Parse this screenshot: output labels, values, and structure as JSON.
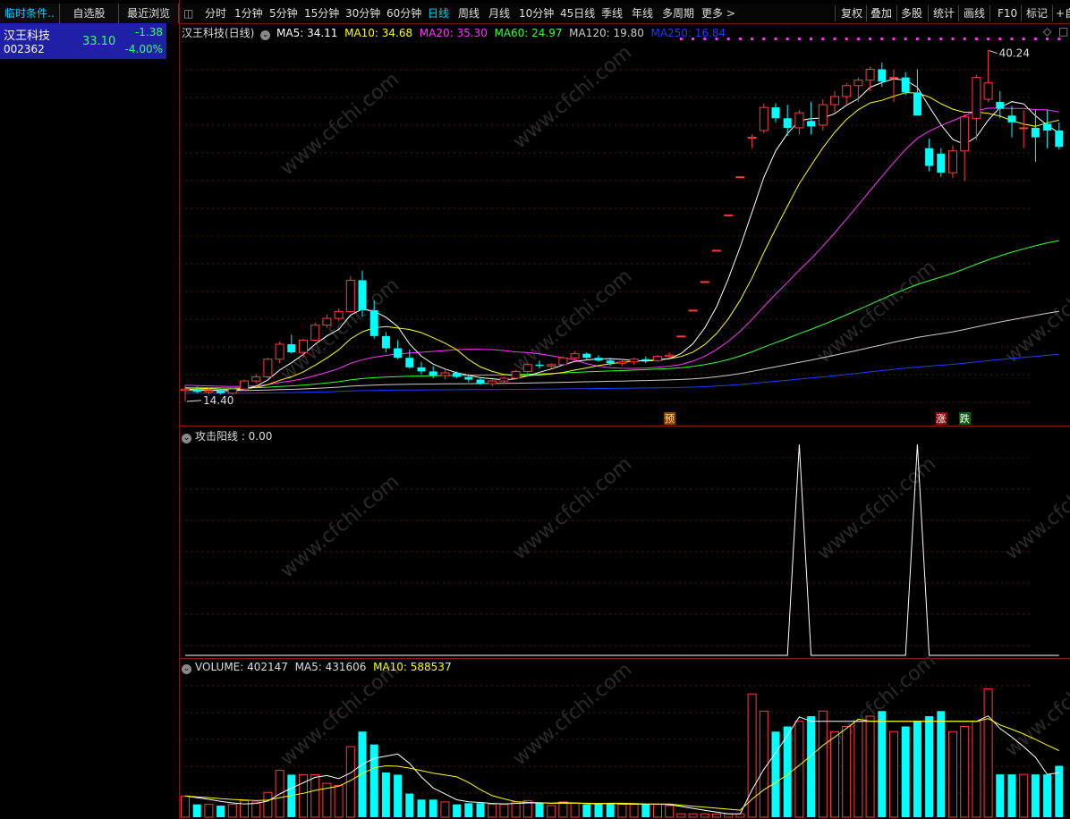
{
  "left_panel": {
    "tabs": [
      "临时条件..",
      "自选股",
      "最近浏览"
    ],
    "stock": {
      "name": "汉王科技",
      "code": "002362",
      "price": "33.10",
      "change": "-1.38",
      "change_pct": "-4.00%"
    }
  },
  "toolbar": {
    "periods": [
      "分时",
      "1分钟",
      "5分钟",
      "15分钟",
      "30分钟",
      "60分钟",
      "日线",
      "周线",
      "月线",
      "10分钟",
      "45日线",
      "季线",
      "年线",
      "多周期",
      "更多"
    ],
    "active_period": "日线",
    "more_arrow": ">",
    "right_buttons": [
      "复权",
      "叠加",
      "多股",
      "统计",
      "画线",
      "F10",
      "标记",
      "+自"
    ]
  },
  "main_chart": {
    "title": "汉王科技(日线)",
    "ma_legend": [
      {
        "label": "MA5: 34.11",
        "color": "#ffffff"
      },
      {
        "label": "MA10: 34.68",
        "color": "#ffff00"
      },
      {
        "label": "MA20: 35.30",
        "color": "#ff33ff"
      },
      {
        "label": "MA60: 24.97",
        "color": "#33ff33"
      },
      {
        "label": "MA120: 19.80",
        "color": "#cccccc"
      },
      {
        "label": "MA250: 16.84",
        "color": "#1e3cff"
      }
    ],
    "high_label": "40.24",
    "low_label": "14.40",
    "markers": [
      {
        "text": "预",
        "bg": "#8a4a00",
        "color": "#ffcc99"
      },
      {
        "text": "涨",
        "bg": "#8a1010",
        "color": "#ffffff"
      },
      {
        "text": "跌",
        "bg": "#106010",
        "color": "#ffffff"
      }
    ]
  },
  "indicator_chart": {
    "title": "攻击阳线 : 0.00"
  },
  "volume_chart": {
    "legend": [
      {
        "label": "VOLUME: 402147",
        "color": "#dddddd"
      },
      {
        "label": "MA5: 431606",
        "color": "#dddddd"
      },
      {
        "label": "MA10: 588537",
        "color": "#ffff00"
      }
    ]
  },
  "watermark": "www.cfchi.com",
  "chart_data": {
    "type": "candlestick",
    "title": "汉王科技(日线)",
    "ohlc": [
      [
        15.2,
        15.6,
        14.4,
        15.3
      ],
      [
        15.3,
        15.5,
        15.0,
        15.1
      ],
      [
        15.1,
        15.4,
        14.9,
        15.2
      ],
      [
        15.2,
        15.3,
        14.9,
        15.0
      ],
      [
        15.0,
        15.4,
        14.9,
        15.3
      ],
      [
        15.3,
        16.0,
        15.2,
        15.9
      ],
      [
        15.9,
        16.4,
        15.7,
        16.2
      ],
      [
        16.2,
        17.6,
        16.1,
        17.5
      ],
      [
        17.5,
        18.8,
        17.2,
        18.6
      ],
      [
        18.6,
        19.3,
        17.9,
        18.0
      ],
      [
        18.0,
        19.0,
        17.6,
        18.9
      ],
      [
        18.9,
        20.2,
        18.8,
        20.0
      ],
      [
        20.0,
        20.8,
        19.8,
        20.5
      ],
      [
        20.5,
        21.2,
        20.3,
        21.0
      ],
      [
        21.0,
        23.6,
        20.9,
        23.3
      ],
      [
        23.3,
        24.0,
        20.6,
        21.1
      ],
      [
        21.1,
        21.8,
        19.0,
        19.2
      ],
      [
        19.2,
        19.5,
        18.0,
        18.3
      ],
      [
        18.3,
        18.9,
        17.5,
        17.6
      ],
      [
        17.6,
        18.2,
        16.8,
        16.9
      ],
      [
        16.9,
        17.3,
        16.4,
        16.6
      ],
      [
        16.6,
        17.0,
        16.1,
        16.3
      ],
      [
        16.3,
        16.7,
        16.0,
        16.5
      ],
      [
        16.5,
        16.6,
        16.1,
        16.2
      ],
      [
        16.2,
        16.4,
        15.8,
        16.0
      ],
      [
        16.0,
        16.2,
        15.6,
        15.7
      ],
      [
        15.7,
        16.0,
        15.5,
        15.9
      ],
      [
        15.9,
        16.2,
        15.7,
        16.1
      ],
      [
        16.1,
        16.7,
        16.0,
        16.6
      ],
      [
        16.6,
        17.2,
        16.4,
        17.1
      ],
      [
        17.1,
        17.4,
        16.8,
        17.0
      ],
      [
        17.0,
        17.2,
        16.8,
        17.1
      ],
      [
        17.1,
        17.7,
        17.0,
        17.6
      ],
      [
        17.6,
        18.1,
        17.5,
        17.9
      ],
      [
        17.9,
        18.0,
        17.5,
        17.6
      ],
      [
        17.6,
        17.8,
        17.3,
        17.4
      ],
      [
        17.4,
        17.6,
        17.0,
        17.2
      ],
      [
        17.2,
        17.5,
        17.0,
        17.3
      ],
      [
        17.3,
        17.6,
        17.1,
        17.5
      ],
      [
        17.5,
        17.7,
        17.2,
        17.4
      ],
      [
        17.4,
        17.8,
        17.3,
        17.7
      ],
      [
        17.7,
        18.0,
        17.6,
        17.8
      ],
      [
        19.2,
        19.2,
        19.2,
        19.2
      ],
      [
        21.1,
        21.1,
        21.1,
        21.1
      ],
      [
        23.2,
        23.2,
        23.2,
        23.2
      ],
      [
        25.5,
        25.5,
        25.5,
        25.5
      ],
      [
        28.1,
        28.1,
        28.1,
        28.1
      ],
      [
        30.9,
        30.9,
        30.9,
        30.9
      ],
      [
        33.8,
        34.0,
        33.0,
        33.8
      ],
      [
        34.3,
        36.3,
        34.1,
        36.0
      ],
      [
        36.0,
        36.3,
        34.9,
        35.2
      ],
      [
        35.2,
        36.2,
        33.9,
        34.5
      ],
      [
        34.5,
        35.8,
        34.0,
        35.6
      ],
      [
        35.0,
        36.4,
        34.0,
        34.6
      ],
      [
        34.7,
        36.6,
        34.3,
        36.2
      ],
      [
        36.2,
        37.2,
        35.6,
        36.8
      ],
      [
        36.8,
        37.8,
        36.2,
        37.6
      ],
      [
        37.6,
        38.2,
        36.4,
        38.0
      ],
      [
        38.0,
        39.0,
        37.2,
        38.8
      ],
      [
        38.8,
        39.3,
        37.5,
        37.9
      ],
      [
        38.2,
        38.8,
        36.4,
        38.2
      ],
      [
        38.2,
        38.6,
        36.9,
        37.1
      ],
      [
        37.1,
        38.8,
        36.0,
        35.4
      ],
      [
        33.0,
        33.7,
        31.3,
        31.7
      ],
      [
        32.6,
        33.0,
        30.9,
        31.2
      ],
      [
        31.2,
        33.2,
        30.8,
        32.8
      ],
      [
        32.8,
        35.5,
        30.6,
        35.3
      ],
      [
        35.2,
        38.4,
        33.6,
        38.2
      ],
      [
        36.6,
        40.24,
        36.4,
        37.8
      ],
      [
        36.4,
        37.2,
        35.2,
        35.9
      ],
      [
        35.4,
        36.1,
        33.8,
        34.9
      ],
      [
        34.5,
        35.8,
        33.0,
        34.5
      ],
      [
        34.5,
        35.8,
        32.0,
        33.8
      ],
      [
        34.8,
        35.8,
        33.0,
        34.3
      ],
      [
        34.3,
        34.9,
        32.9,
        33.1
      ]
    ],
    "indicator_attack_yang": {
      "values_nonzero": [
        {
          "index": 52,
          "value": 1
        },
        {
          "index": 62,
          "value": 1
        }
      ],
      "default": 0
    },
    "volume_note": "bars coloured red (up) / cyan (down)",
    "ylabel": "",
    "xlabel": ""
  }
}
